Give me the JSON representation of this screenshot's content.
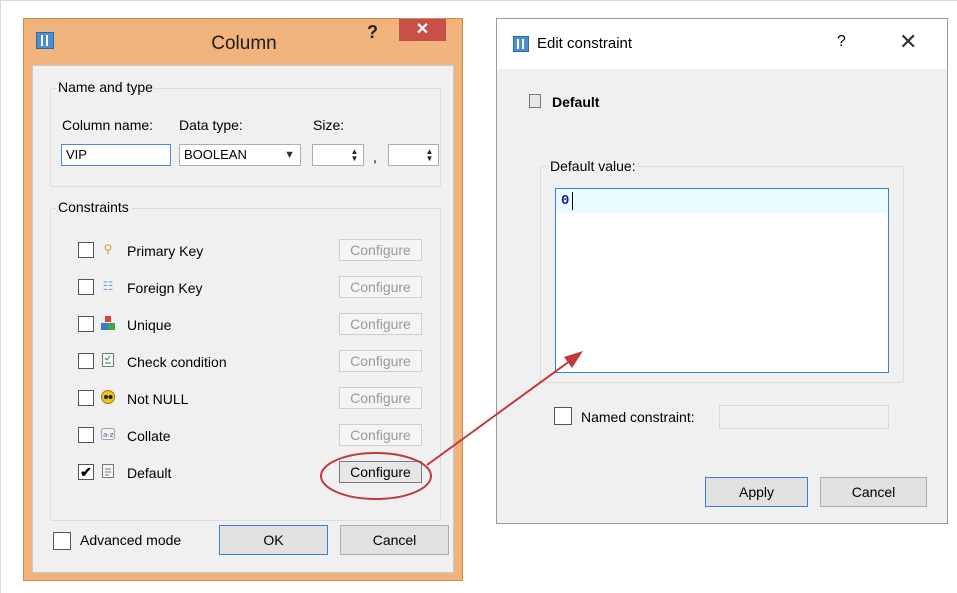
{
  "column_dialog": {
    "title": "Column",
    "help": "?",
    "close": "✕",
    "name_group": {
      "legend": "Name and type",
      "column_name_label": "Column name:",
      "data_type_label": "Data type:",
      "size_label": "Size:",
      "column_name_value": "VIP",
      "data_type_value": "BOOLEAN",
      "size_separator": ","
    },
    "constraints_group": {
      "legend": "Constraints",
      "items": [
        {
          "label": "Primary Key",
          "checked": false,
          "icon": "key-icon",
          "configure": "Configure"
        },
        {
          "label": "Foreign Key",
          "checked": false,
          "icon": "foreign-key-icon",
          "configure": "Configure"
        },
        {
          "label": "Unique",
          "checked": false,
          "icon": "unique-icon",
          "configure": "Configure"
        },
        {
          "label": "Check condition",
          "checked": false,
          "icon": "check-condition-icon",
          "configure": "Configure"
        },
        {
          "label": "Not NULL",
          "checked": false,
          "icon": "not-null-icon",
          "configure": "Configure"
        },
        {
          "label": "Collate",
          "checked": false,
          "icon": "collate-icon",
          "configure": "Configure"
        },
        {
          "label": "Default",
          "checked": true,
          "icon": "default-icon",
          "configure": "Configure"
        }
      ]
    },
    "advanced_mode_label": "Advanced mode",
    "ok_label": "OK",
    "cancel_label": "Cancel"
  },
  "edit_constraint_dialog": {
    "title": "Edit constraint",
    "help": "?",
    "close": "✕",
    "heading": "Default",
    "default_value_legend": "Default value:",
    "default_value_text": "0",
    "named_constraint_label": "Named constraint:",
    "apply_label": "Apply",
    "cancel_label": "Cancel"
  },
  "annotation": {
    "color": "#c0393b"
  }
}
